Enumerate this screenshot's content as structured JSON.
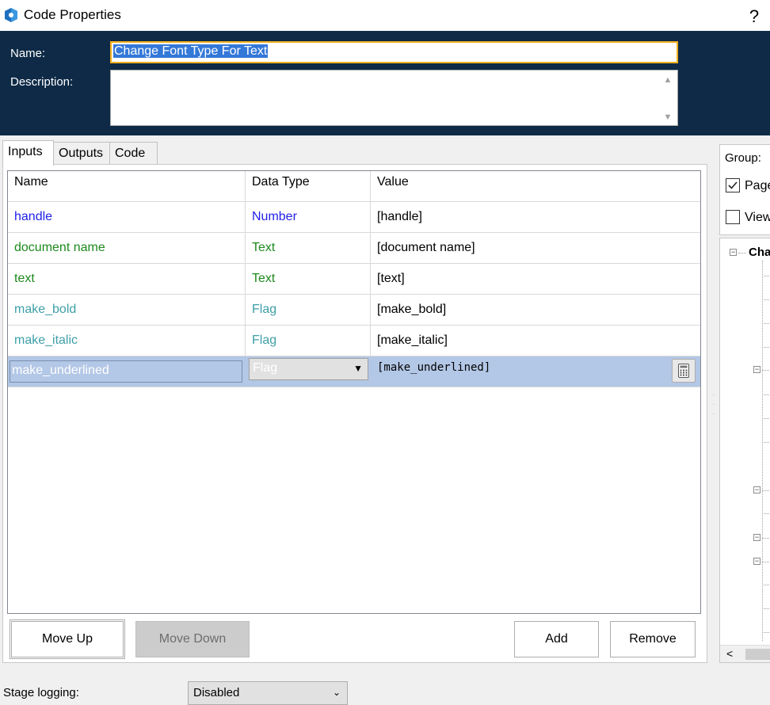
{
  "window": {
    "title": "Code Properties",
    "help": "?"
  },
  "header": {
    "name_label": "Name:",
    "name_value": "Change Font Type For Text",
    "description_label": "Description:",
    "description_value": ""
  },
  "tabs": [
    {
      "label": "Inputs",
      "active": true
    },
    {
      "label": "Outputs",
      "active": false
    },
    {
      "label": "Code",
      "active": false
    }
  ],
  "grid": {
    "columns": [
      "Name",
      "Data Type",
      "Value"
    ],
    "rows": [
      {
        "name": "handle",
        "type": "Number",
        "value": "[handle]",
        "color": "#1f1fe8"
      },
      {
        "name": "document name",
        "type": "Text",
        "value": "[document name]",
        "color": "#1d8a1d"
      },
      {
        "name": "text",
        "type": "Text",
        "value": "[text]",
        "color": "#1d8a1d"
      },
      {
        "name": "make_bold",
        "type": "Flag",
        "value": "[make_bold]",
        "color": "#3d9fa7"
      },
      {
        "name": "make_italic",
        "type": "Flag",
        "value": "[make_italic]",
        "color": "#3d9fa7"
      }
    ],
    "editing_row": {
      "name": "make_underlined",
      "type": "Flag",
      "value": "[make_underlined]"
    }
  },
  "buttons": {
    "move_up": "Move Up",
    "move_down": "Move Down",
    "add": "Add",
    "remove": "Remove"
  },
  "right_panel": {
    "group_label": "Group:",
    "checkbox_1": {
      "label": "Page",
      "checked": true
    },
    "checkbox_2": {
      "label": "View",
      "checked": false
    },
    "tree_root": "Cha"
  },
  "footer": {
    "stage_logging_label": "Stage logging:",
    "stage_logging_value": "Disabled"
  }
}
